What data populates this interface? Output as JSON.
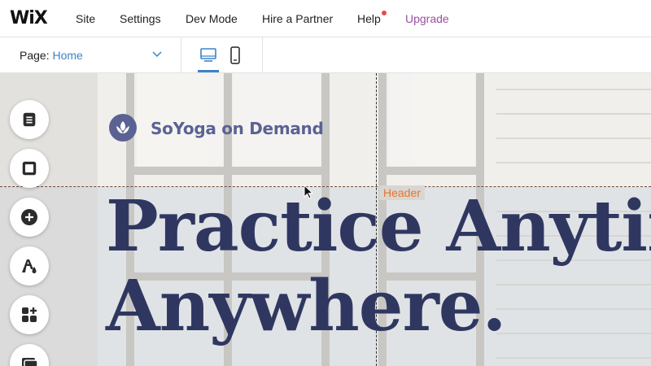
{
  "topbar": {
    "logo": "WiX",
    "menu": [
      {
        "label": "Site"
      },
      {
        "label": "Settings"
      },
      {
        "label": "Dev Mode"
      },
      {
        "label": "Hire a Partner"
      },
      {
        "label": "Help"
      },
      {
        "label": "Upgrade"
      }
    ],
    "help_notification_color": "#e8484d",
    "upgrade_color": "#9a4ea3"
  },
  "subbar": {
    "page_label": "Page:",
    "page_value": "Home",
    "devices": [
      {
        "name": "desktop-icon",
        "selected": true
      },
      {
        "name": "mobile-icon",
        "selected": false
      }
    ],
    "accent": "#3b84c7"
  },
  "canvas": {
    "site_name": "SoYoga on Demand",
    "section_tag": "Header",
    "headline_line1": "Practice Anytime",
    "headline_line2": "Anywhere.",
    "headline_color": "#2f3761",
    "brand_color": "#5b6293"
  },
  "left_tools": [
    {
      "name": "pages-icon"
    },
    {
      "name": "background-icon"
    },
    {
      "name": "add-icon"
    },
    {
      "name": "theme-icon"
    },
    {
      "name": "apps-icon"
    },
    {
      "name": "media-icon"
    }
  ]
}
